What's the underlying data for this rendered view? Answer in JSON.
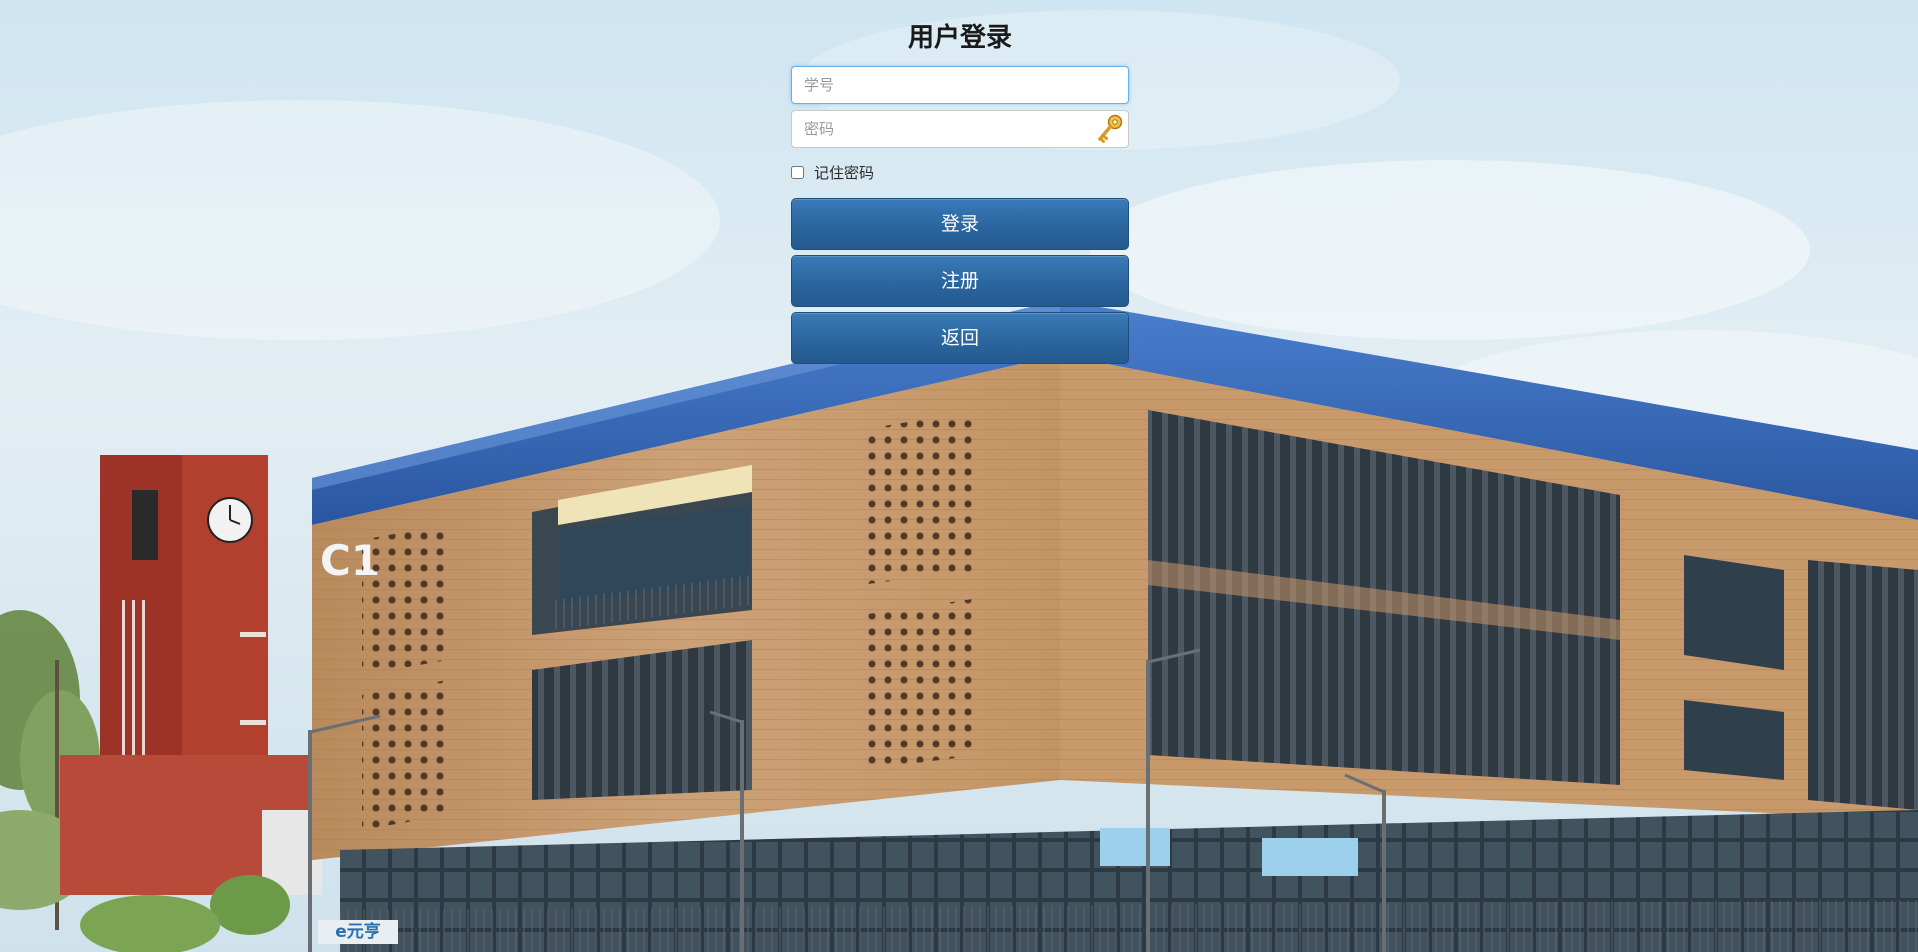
{
  "login": {
    "title": "用户登录",
    "student_id_placeholder": "学号",
    "password_placeholder": "密码",
    "remember_label": "记住密码",
    "remember_checked": false,
    "login_button": "登录",
    "register_button": "注册",
    "back_button": "返回"
  },
  "background": {
    "building_sign": "C1",
    "signage_text": "e元亨",
    "sky_color": "#d9eaf2",
    "roof_color": "#2f5fb0",
    "facade_color": "#c79a6c",
    "tower_color": "#b23b30"
  },
  "icons": {
    "password_field": "key-icon"
  },
  "colors": {
    "button_primary": "#2c67a0",
    "input_focus_border": "#66afe9"
  }
}
